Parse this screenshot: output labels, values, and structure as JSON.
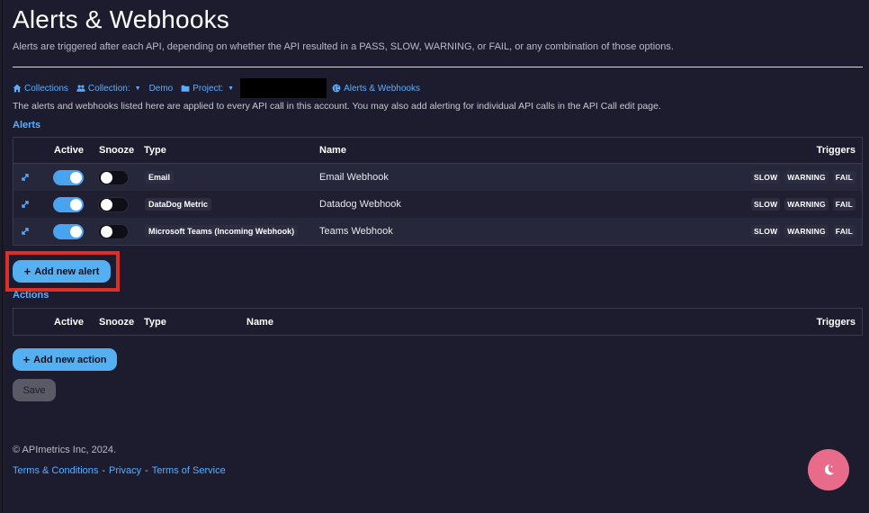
{
  "header": {
    "title": "Alerts & Webhooks",
    "subtitle": "Alerts are triggered after each API, depending on whether the API resulted in a PASS, SLOW, WARNING, or FAIL, or any combination of those options."
  },
  "breadcrumb": {
    "collections": "Collections",
    "collection_label": "Collection:",
    "collection_value": "Demo",
    "project_label": "Project:",
    "current": "Alerts & Webhooks"
  },
  "info_text": "The alerts and webhooks listed here are applied to every API call in this account. You may also add alerting for individual API calls in the API Call edit page.",
  "alerts": {
    "section_title": "Alerts",
    "columns": {
      "active": "Active",
      "snooze": "Snooze",
      "type": "Type",
      "name": "Name",
      "triggers": "Triggers"
    },
    "rows": [
      {
        "type": "Email",
        "name": "Email Webhook",
        "active": true,
        "snooze": false,
        "triggers": [
          "SLOW",
          "WARNING",
          "FAIL"
        ]
      },
      {
        "type": "DataDog Metric",
        "name": "Datadog Webhook",
        "active": true,
        "snooze": false,
        "triggers": [
          "SLOW",
          "WARNING",
          "FAIL"
        ]
      },
      {
        "type": "Microsoft Teams (Incoming Webhook)",
        "name": "Teams Webhook",
        "active": true,
        "snooze": false,
        "triggers": [
          "SLOW",
          "WARNING",
          "FAIL"
        ]
      }
    ],
    "add_button": "Add new alert"
  },
  "actions": {
    "section_title": "Actions",
    "columns": {
      "active": "Active",
      "snooze": "Snooze",
      "type": "Type",
      "name": "Name",
      "triggers": "Triggers"
    },
    "add_button": "Add new action"
  },
  "save_button": "Save",
  "footer": {
    "copyright": "© APImetrics Inc, 2024.",
    "terms": "Terms & Conditions",
    "separator": "-",
    "privacy": "Privacy",
    "tos": "Terms of Service"
  },
  "colors": {
    "background": "#1c1c2e",
    "accent": "#5aaeff",
    "toggle_on": "#4aa3f0",
    "fab": "#e86b8c",
    "highlight": "#d9302a"
  },
  "icons": {
    "home": "home-icon",
    "users": "users-icon",
    "folder": "folder-icon",
    "globe": "globe-icon",
    "expand": "expand-icon",
    "plus": "plus-icon",
    "theme": "moon-icon"
  }
}
